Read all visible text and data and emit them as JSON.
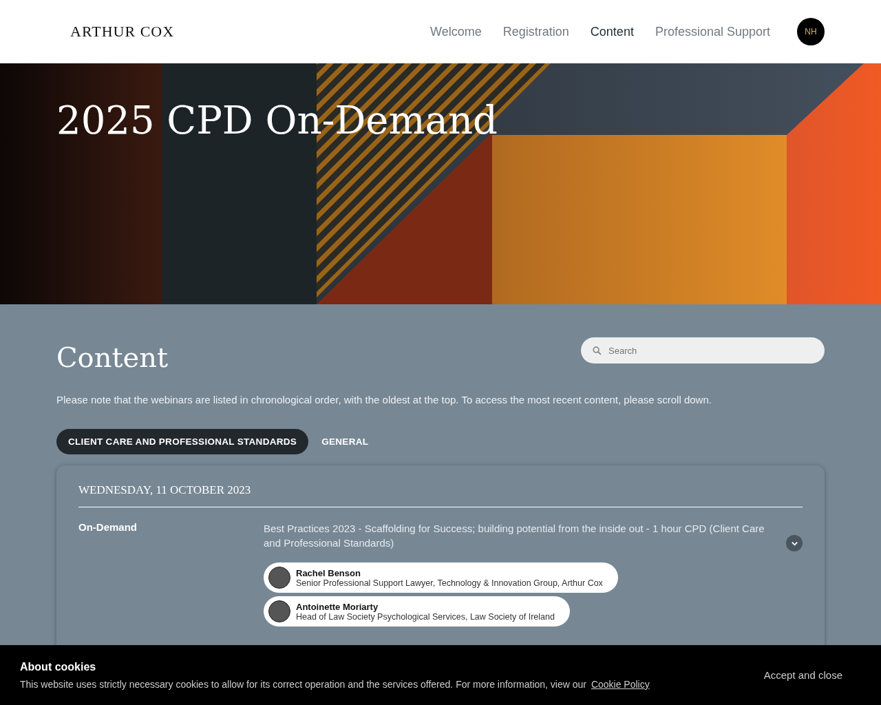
{
  "header": {
    "logo": "ARTHUR COX",
    "nav": [
      {
        "label": "Welcome",
        "selected": false
      },
      {
        "label": "Registration",
        "selected": false
      },
      {
        "label": "Content",
        "selected": true
      },
      {
        "label": "Professional Support",
        "selected": false
      }
    ],
    "user_initials": "NH"
  },
  "hero": {
    "title": "2025 CPD On-Demand"
  },
  "content": {
    "title": "Content",
    "search": {
      "placeholder": "Search"
    },
    "note": "Please note that the webinars are listed in chronological order, with the oldest at the top.  To access the most recent content, please scroll down.",
    "tabs": [
      {
        "label": "CLIENT CARE AND PROFESSIONAL STANDARDS",
        "selected": true
      },
      {
        "label": "GENERAL",
        "selected": false
      }
    ],
    "sessions": [
      {
        "date": "WEDNESDAY, 11 OCTOBER 2023",
        "type": "On-Demand",
        "title": "Best Practices 2023 - Scaffolding for Success; building potential from the inside out - 1 hour CPD (Client Care and Professional Standards)",
        "expanded": false,
        "speakers": [
          {
            "name": "Rachel Benson",
            "role": "Senior Professional Support Lawyer, Technology & Innovation Group, Arthur Cox"
          },
          {
            "name": "Antoinette Moriarty",
            "role": "Head of Law Society Psychological Services, Law Society of Ireland"
          }
        ]
      }
    ]
  },
  "cookie_banner": {
    "title": "About cookies",
    "text": "This website uses strictly necessary cookies to allow for its correct operation and the services offered. For more information, view our",
    "link": "Cookie Policy",
    "button": "Accept and close"
  }
}
